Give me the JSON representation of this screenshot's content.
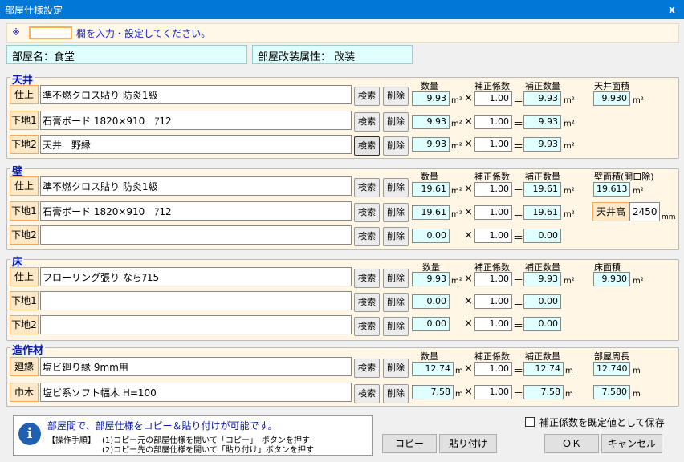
{
  "window": {
    "title": "部屋仕様設定",
    "close": "x"
  },
  "note": {
    "mark": "※",
    "text": "欄を入力・設定してください。"
  },
  "room": {
    "name_label": "部屋名：食堂",
    "attr_label": "部屋改装属性： 改装"
  },
  "buttons": {
    "search": "検索",
    "delete": "削除",
    "copy": "コピー",
    "paste": "貼り付け",
    "ok": "ＯＫ",
    "cancel": "キャンセル"
  },
  "symbols": {
    "times": "×",
    "equals": "＝"
  },
  "headers": {
    "qty": "数量",
    "coef": "補正係数",
    "corrected": "補正数量"
  },
  "sections": {
    "ceiling": {
      "title": "天井",
      "area_label": "天井面積",
      "area_value": "9.930",
      "area_unit": "m²",
      "rows": [
        {
          "label": "仕上",
          "spec": "準不燃クロス貼り 防炎1級",
          "qty": "9.93",
          "unit": "m²",
          "coef": "1.00",
          "corrected": "9.93",
          "cunit": "m²"
        },
        {
          "label": "下地1",
          "spec": "石膏ボード 1820×910　ｱ12",
          "qty": "9.93",
          "unit": "m²",
          "coef": "1.00",
          "corrected": "9.93",
          "cunit": "m²"
        },
        {
          "label": "下地2",
          "spec": "天井　野縁",
          "qty": "9.93",
          "unit": "m²",
          "coef": "1.00",
          "corrected": "9.93",
          "cunit": "m²"
        }
      ]
    },
    "wall": {
      "title": "壁",
      "area_label": "壁面積(開口除)",
      "area_value": "19.613",
      "area_unit": "m²",
      "height_label": "天井高",
      "height_value": "2450",
      "height_unit": "mm",
      "rows": [
        {
          "label": "仕上",
          "spec": "準不燃クロス貼り 防炎1級",
          "qty": "19.61",
          "unit": "m²",
          "coef": "1.00",
          "corrected": "19.61",
          "cunit": "m²"
        },
        {
          "label": "下地1",
          "spec": "石膏ボード 1820×910　ｱ12",
          "qty": "19.61",
          "unit": "m²",
          "coef": "1.00",
          "corrected": "19.61",
          "cunit": "m²"
        },
        {
          "label": "下地2",
          "spec": "",
          "qty": "0.00",
          "unit": "",
          "coef": "1.00",
          "corrected": "0.00",
          "cunit": ""
        }
      ]
    },
    "floor": {
      "title": "床",
      "area_label": "床面積",
      "area_value": "9.930",
      "area_unit": "m²",
      "rows": [
        {
          "label": "仕上",
          "spec": "フローリング張り ならｱ15",
          "qty": "9.93",
          "unit": "m²",
          "coef": "1.00",
          "corrected": "9.93",
          "cunit": "m²"
        },
        {
          "label": "下地1",
          "spec": "",
          "qty": "0.00",
          "unit": "",
          "coef": "1.00",
          "corrected": "0.00",
          "cunit": ""
        },
        {
          "label": "下地2",
          "spec": "",
          "qty": "0.00",
          "unit": "",
          "coef": "1.00",
          "corrected": "0.00",
          "cunit": ""
        }
      ]
    },
    "fixture": {
      "title": "造作材",
      "area_label": "部屋周長",
      "area_value": "12.740",
      "area_unit": "m",
      "area2_value": "7.580",
      "area2_unit": "m",
      "rows": [
        {
          "label": "廻縁",
          "spec": "塩ビ廻り縁 9mm用",
          "qty": "12.74",
          "unit": "m",
          "coef": "1.00",
          "corrected": "12.74",
          "cunit": "m"
        },
        {
          "label": "巾木",
          "spec": "塩ビ系ソフト幅木 H=100",
          "qty": "7.58",
          "unit": "m",
          "coef": "1.00",
          "corrected": "7.58",
          "cunit": "m"
        }
      ]
    }
  },
  "help": {
    "title": "部屋間で、部屋仕様をコピー＆貼り付けが可能です。",
    "steps_label": "【操作手順】",
    "step1": "(1)コピー元の部屋仕様を開いて「コピー」　ボタンを押す",
    "step2": "(2)コピー先の部屋仕様を開いて「貼り付け」ボタンを押す"
  },
  "checkbox": {
    "label": "補正係数を既定値として保存"
  },
  "colors": {
    "title_bar": "#0078d7",
    "section_title": "#0a1aa8",
    "cyan_field": "#e0ffff",
    "label_bg": "#fde8c8"
  }
}
